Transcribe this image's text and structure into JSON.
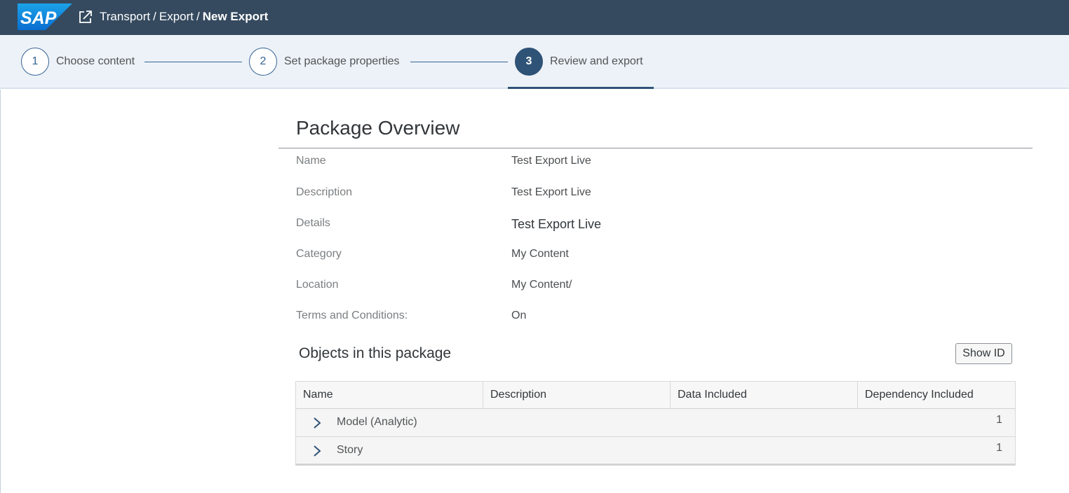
{
  "shell": {
    "logo_text": "SAP",
    "logo_icon": "sap-logo",
    "breadcrumb_icon": "export-icon",
    "breadcrumb": [
      "Transport",
      "Export"
    ],
    "separator": "/",
    "current": "New Export"
  },
  "wizard": {
    "steps": [
      {
        "number": "1",
        "label": "Choose content"
      },
      {
        "number": "2",
        "label": "Set package properties"
      },
      {
        "number": "3",
        "label": "Review and export"
      }
    ],
    "active_step": 3
  },
  "overview": {
    "title": "Package Overview",
    "fields": [
      {
        "label": "Name",
        "value": "Test Export Live"
      },
      {
        "label": "Description",
        "value": "Test Export Live"
      },
      {
        "label": "Details",
        "value": "Test Export Live"
      },
      {
        "label": "Category",
        "value": "My Content"
      },
      {
        "label": "Location",
        "value": "My Content/"
      },
      {
        "label": "Terms and Conditions:",
        "value": "On"
      }
    ]
  },
  "objects": {
    "title": "Objects in this package",
    "show_id_label": "Show ID",
    "columns": [
      "Name",
      "Description",
      "Data Included",
      "Dependency Included"
    ],
    "rows": [
      {
        "name": "Model (Analytic)",
        "count": "1"
      },
      {
        "name": "Story",
        "count": "1"
      }
    ]
  },
  "colors": {
    "shell": "#354a5f",
    "wizard_bg": "#edf2f8",
    "accent": "#2f5377"
  }
}
